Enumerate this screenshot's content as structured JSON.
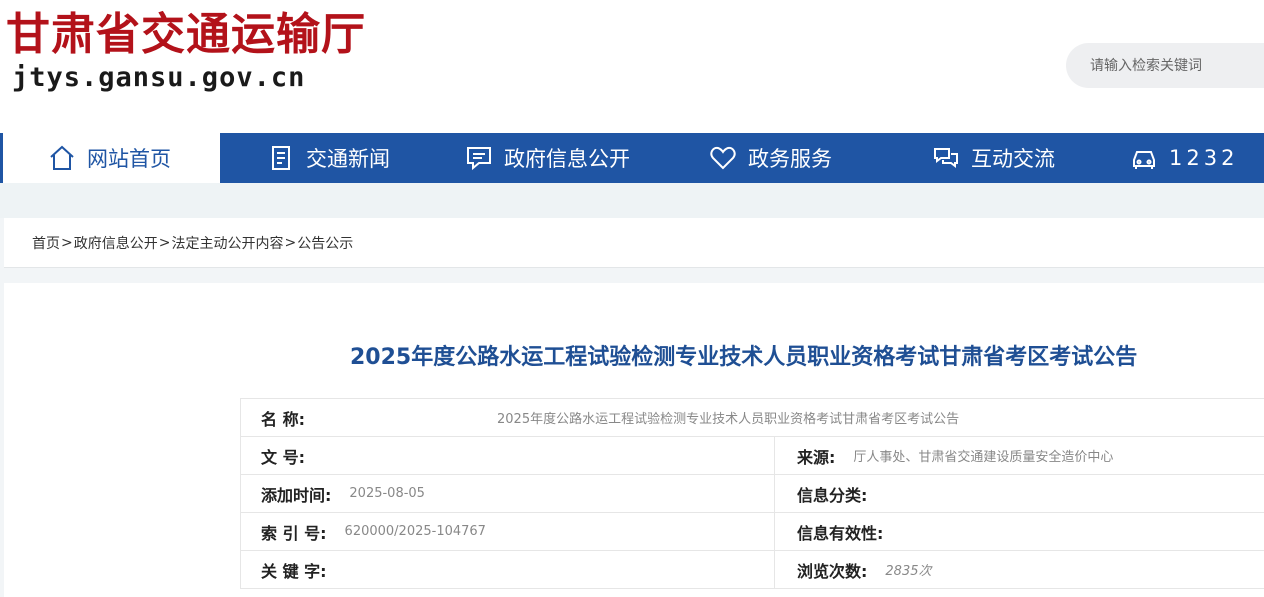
{
  "header": {
    "logo_title": "甘肃省交通运输厅",
    "logo_url": "jtys.gansu.gov.cn",
    "search_placeholder": "请输入检索关键词"
  },
  "nav": {
    "items": [
      {
        "label": "网站首页",
        "icon": "home-icon"
      },
      {
        "label": "交通新闻",
        "icon": "document-icon"
      },
      {
        "label": "政府信息公开",
        "icon": "chat-icon"
      },
      {
        "label": "政务服务",
        "icon": "heart-icon"
      },
      {
        "label": "互动交流",
        "icon": "dialog-icon"
      },
      {
        "label": "1232",
        "icon": "car-icon"
      }
    ]
  },
  "breadcrumb": [
    "首页",
    "政府信息公开",
    "法定主动公开内容",
    "公告公示"
  ],
  "article": {
    "title": "2025年度公路水运工程试验检测专业技术人员职业资格考试甘肃省考区考试公告",
    "meta": {
      "name_label": "名 称:",
      "name_value": "2025年度公路水运工程试验检测专业技术人员职业资格考试甘肃省考区考试公告",
      "docno_label": "文 号:",
      "docno_value": "",
      "source_label": "来源:",
      "source_value": "厅人事处、甘肃省交通建设质量安全造价中心",
      "date_label": "添加时间:",
      "date_value": "2025-08-05",
      "category_label": "信息分类:",
      "category_value": "",
      "index_label": "索 引 号:",
      "index_value": "620000/2025-104767",
      "validity_label": "信息有效性:",
      "validity_value": "",
      "keywords_label": "关 键 字:",
      "keywords_value": "",
      "views_label": "浏览次数:",
      "views_value": "2835次"
    }
  },
  "colors": {
    "nav_blue": "#1f55a4",
    "logo_red": "#b3121a",
    "title_blue": "#1f4f94"
  }
}
